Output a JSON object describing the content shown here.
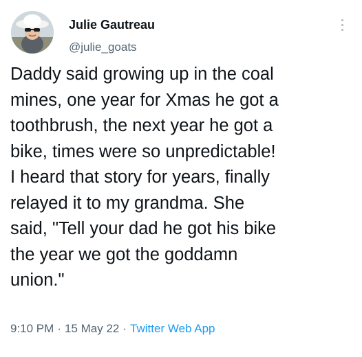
{
  "author": {
    "display_name": "Julie Gautreau",
    "handle": "@julie_goats",
    "avatar_icon": "avatar-photo"
  },
  "tweet": {
    "lines": [
      "Daddy said growing up in the coal",
      "mines, one year for Xmas he got a",
      "toothbrush, the next year he got a",
      "bike, times were so unpredictable!",
      "I heard that story for years, finally",
      "relayed it to my grandma. She",
      "said, \"Tell your dad he got his bike",
      "the year we got the goddamn",
      "union.\""
    ]
  },
  "meta": {
    "time": "9:10 PM",
    "separator": "·",
    "date": "15 May 22",
    "source": "Twitter Web App"
  },
  "colors": {
    "text": "#0f1419",
    "secondary": "#536471",
    "link": "#1d9bf0"
  }
}
